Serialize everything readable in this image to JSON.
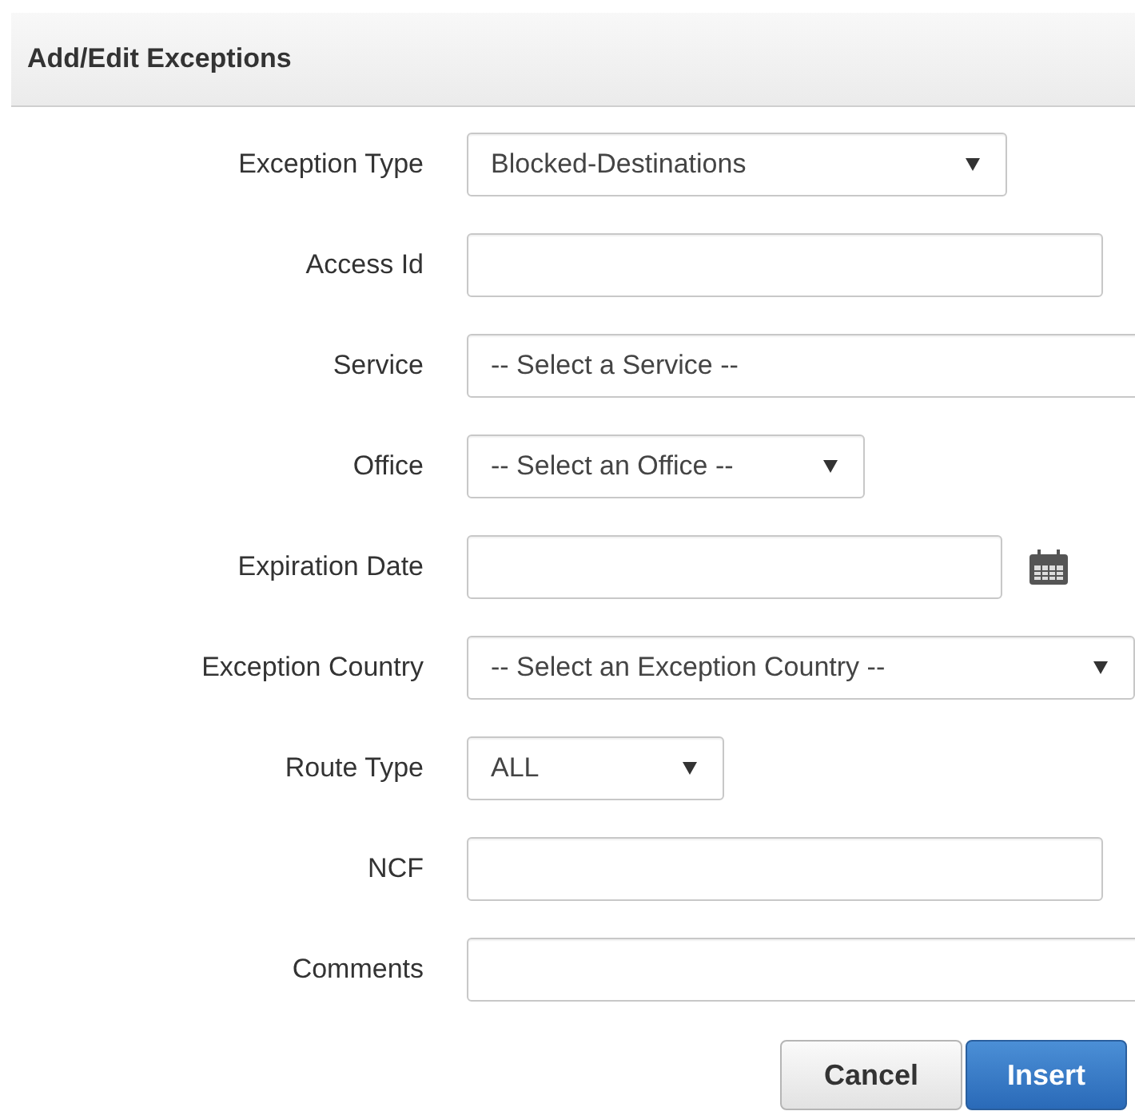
{
  "panel": {
    "title": "Add/Edit Exceptions"
  },
  "fields": [
    {
      "label": "Exception Type",
      "kind": "select",
      "value": "Blocked-Destinations"
    },
    {
      "label": "Access Id",
      "kind": "text"
    },
    {
      "label": "Service",
      "kind": "select",
      "value": "-- Select a Service --"
    },
    {
      "label": "Office",
      "kind": "select",
      "value": "-- Select an Office --"
    },
    {
      "label": "Expiration Date",
      "kind": "date"
    },
    {
      "label": "Exception Country",
      "kind": "select",
      "value": "-- Select an Exception Country --"
    },
    {
      "label": "Route Type",
      "kind": "select",
      "value": "ALL"
    },
    {
      "label": "NCF",
      "kind": "text"
    },
    {
      "label": "Comments",
      "kind": "text"
    }
  ],
  "buttons": [
    {
      "label": "Cancel",
      "kind": "default"
    },
    {
      "label": "Insert",
      "kind": "primary"
    }
  ]
}
